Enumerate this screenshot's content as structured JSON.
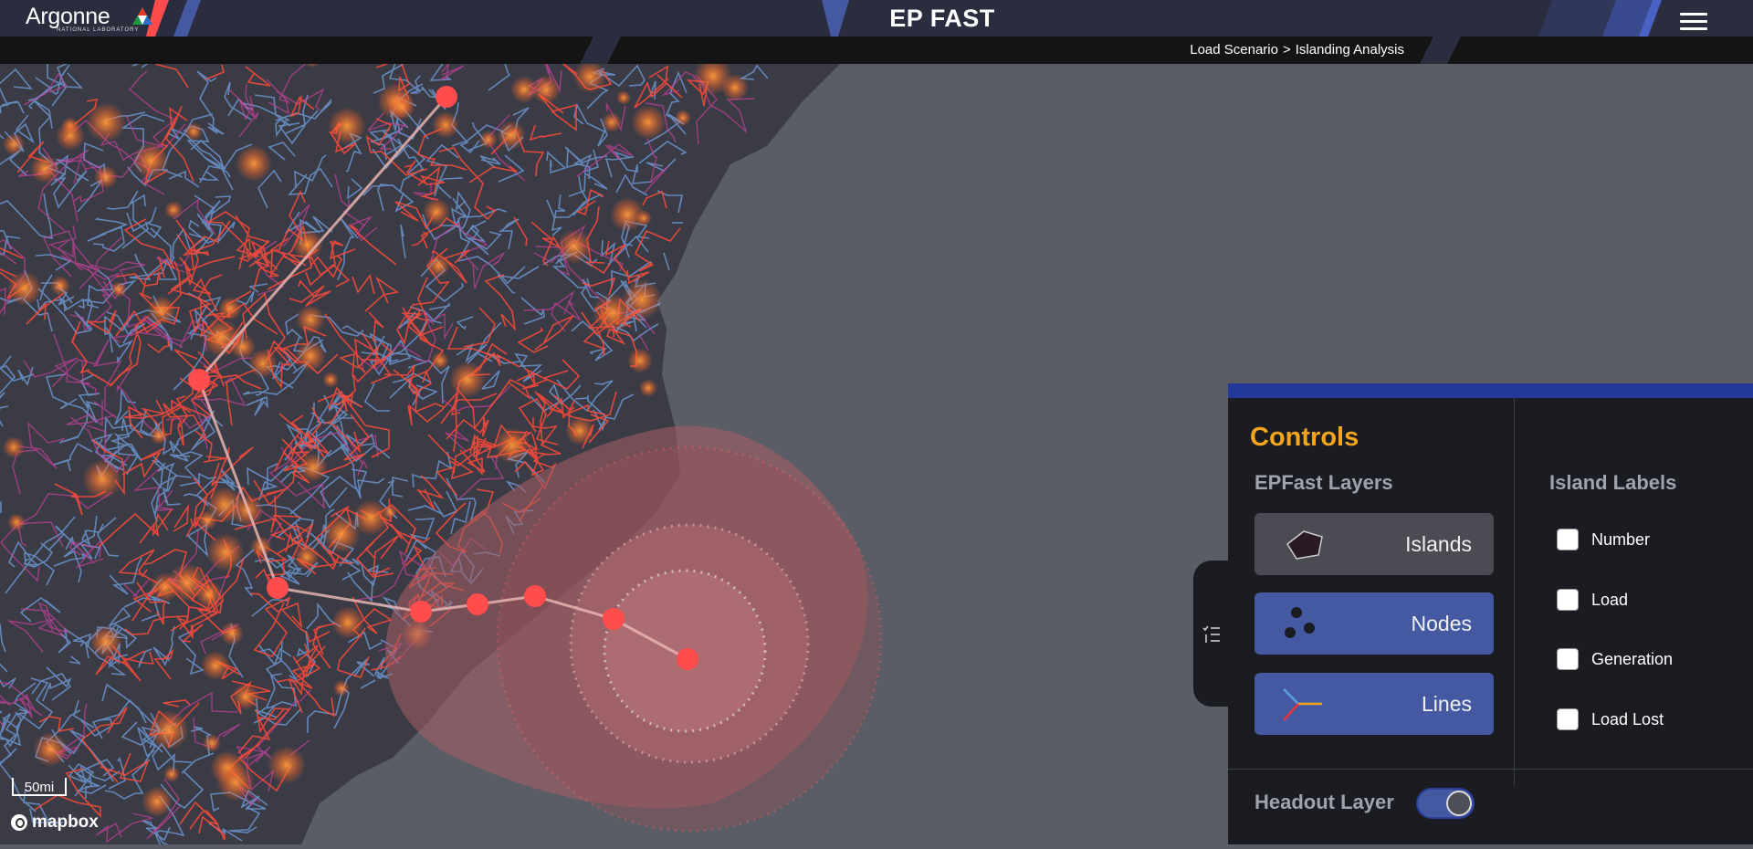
{
  "header": {
    "brand": "Argonne",
    "brand_sub": "NATIONAL LABORATORY",
    "title": "EP FAST",
    "breadcrumb": {
      "first": "Load Scenario",
      "separator": ">",
      "second": "Islanding Analysis"
    }
  },
  "map": {
    "scale_label": "50mi",
    "attribution": "mapbox"
  },
  "controls": {
    "title": "Controls",
    "layers_heading": "EPFast Layers",
    "layers": [
      {
        "label": "Islands"
      },
      {
        "label": "Nodes"
      },
      {
        "label": "Lines"
      }
    ],
    "labels_heading": "Island Labels",
    "labels": [
      {
        "label": "Number"
      },
      {
        "label": "Load"
      },
      {
        "label": "Generation"
      },
      {
        "label": "Load Lost"
      }
    ],
    "headout_label": "Headout Layer",
    "headout_enabled": true
  },
  "colors": {
    "accent": "#f5a41e",
    "button_active": "#4459a2",
    "button_inactive": "#4a4b53",
    "panel_bg": "#1b1c22",
    "header_bg": "#2a2d3d"
  }
}
